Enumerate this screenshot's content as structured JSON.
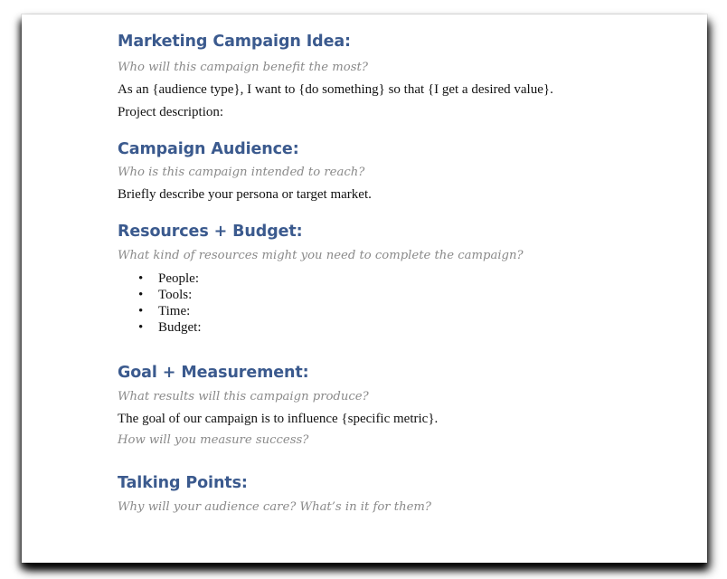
{
  "sections": {
    "campaign_idea": {
      "heading": "Marketing Campaign Idea:",
      "prompt": "Who will this campaign benefit the most?",
      "lines": [
        "As an {audience type}, I want to {do something} so that {I get a desired value}.",
        "Project description:"
      ]
    },
    "audience": {
      "heading": "Campaign Audience:",
      "prompt": "Who is this campaign intended to reach?",
      "lines": [
        "Briefly describe your persona or target market."
      ]
    },
    "resources": {
      "heading": "Resources + Budget:",
      "prompt": "What kind of resources might you need to complete the campaign?",
      "bullet_glyph": "•",
      "items": [
        "People:",
        "Tools:",
        "Time:",
        "Budget:"
      ]
    },
    "goal": {
      "heading": "Goal + Measurement:",
      "prompt": "What results will this campaign produce?",
      "line": "The goal of our campaign is to influence {specific metric}.",
      "prompt2": "How will you measure success?"
    },
    "talking_points": {
      "heading": "Talking Points:",
      "prompt": "Why will your audience care? What’s in it for them?"
    }
  },
  "colors": {
    "heading": "#3b5a8e",
    "prompt": "#8a8a8a",
    "body": "#111111"
  }
}
